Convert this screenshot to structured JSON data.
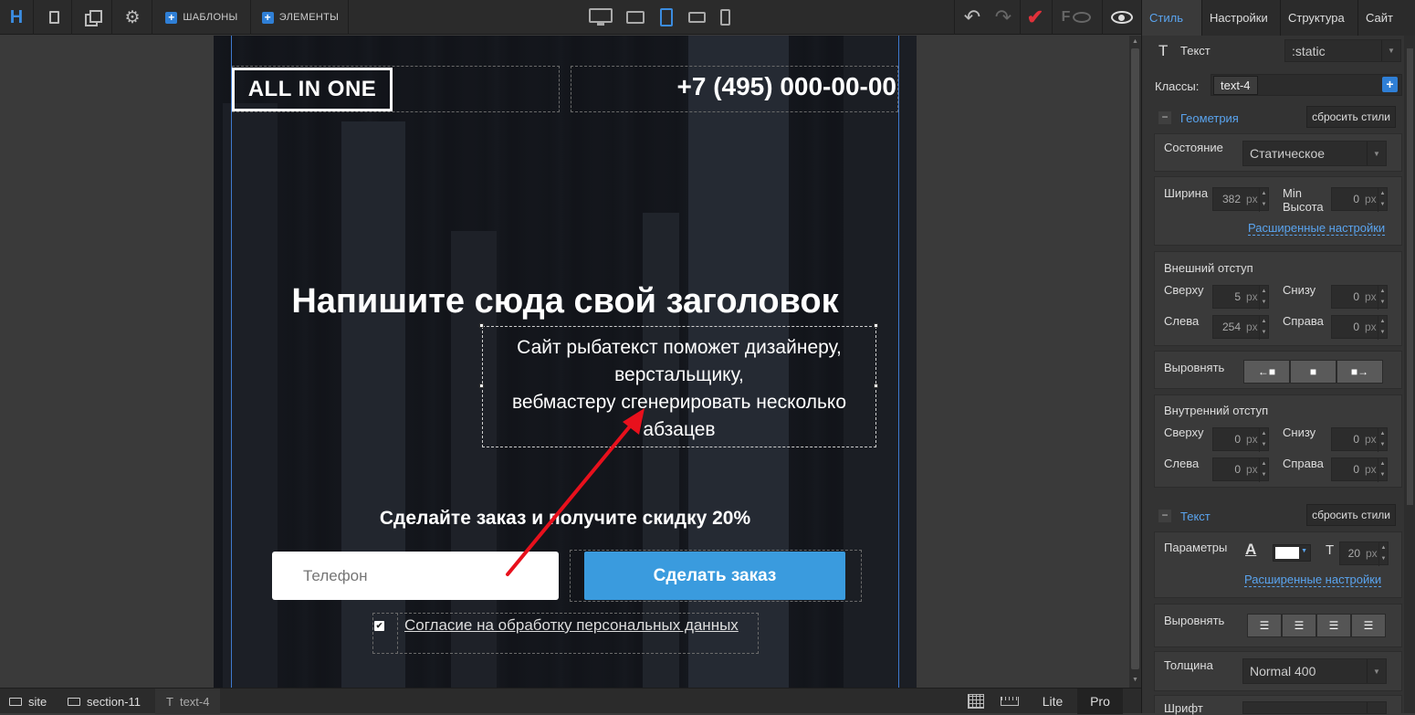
{
  "toolbar": {
    "logo": "H",
    "templates_label": "ШАБЛОНЫ",
    "elements_label": "ЭЛЕМЕНТЫ",
    "undo_icon": "undo-icon",
    "redo_icon": "redo-icon",
    "accent_color": "#3b8ce0",
    "save_color": "#e0313a"
  },
  "page": {
    "brand": "ALL IN ONE",
    "phone": "+7 (495) 000-00-00",
    "headline": "Напишите сюда свой заголовок",
    "paragraph_lines": [
      "Сайт рыбатекст поможет дизайнеру,",
      "верстальщику,",
      "вебмастеру сгенерировать несколько",
      "абзацев"
    ],
    "offer": "Сделайте заказ и получите скидку 20%",
    "phone_placeholder": "Телефон",
    "order_button": "Сделать заказ",
    "consent": "Согласие на обработку персональных данных",
    "button_color": "#3a9bde"
  },
  "panel": {
    "tabs": [
      "Стиль",
      "Настройки",
      "Структура",
      "Сайт"
    ],
    "active_tab": "Стиль",
    "element_type": "Текст",
    "position_value": ":static",
    "classes_label": "Классы:",
    "class_tag": "text-4",
    "geometry": {
      "title": "Геометрия",
      "reset": "сбросить стили",
      "state_label": "Состояние",
      "state_value": "Статическое",
      "width_label": "Ширина",
      "width_value": "382",
      "min_height_label_1": "Min",
      "min_height_label_2": "Высота",
      "min_height_value": "0",
      "advanced": "Расширенные настройки",
      "margin_title": "Внешний отступ",
      "top_label": "Сверху",
      "bottom_label": "Снизу",
      "left_label": "Слева",
      "right_label": "Справа",
      "margin_top": "5",
      "margin_bottom": "0",
      "margin_left": "254",
      "margin_right": "0",
      "align_label": "Выровнять",
      "padding_title": "Внутренний отступ",
      "padding_top": "0",
      "padding_bottom": "0",
      "padding_left": "0",
      "padding_right": "0",
      "unit": "px"
    },
    "text": {
      "title": "Текст",
      "reset": "сбросить стили",
      "params_label": "Параметры",
      "font_size": "20",
      "advanced": "Расширенные настройки",
      "align_label": "Выровнять",
      "weight_label": "Толщина",
      "weight_value": "Normal 400",
      "font_label": "Шрифт"
    }
  },
  "bottom": {
    "crumbs": [
      "site",
      "section-11",
      "text-4"
    ],
    "lite": "Lite",
    "pro": "Pro"
  }
}
